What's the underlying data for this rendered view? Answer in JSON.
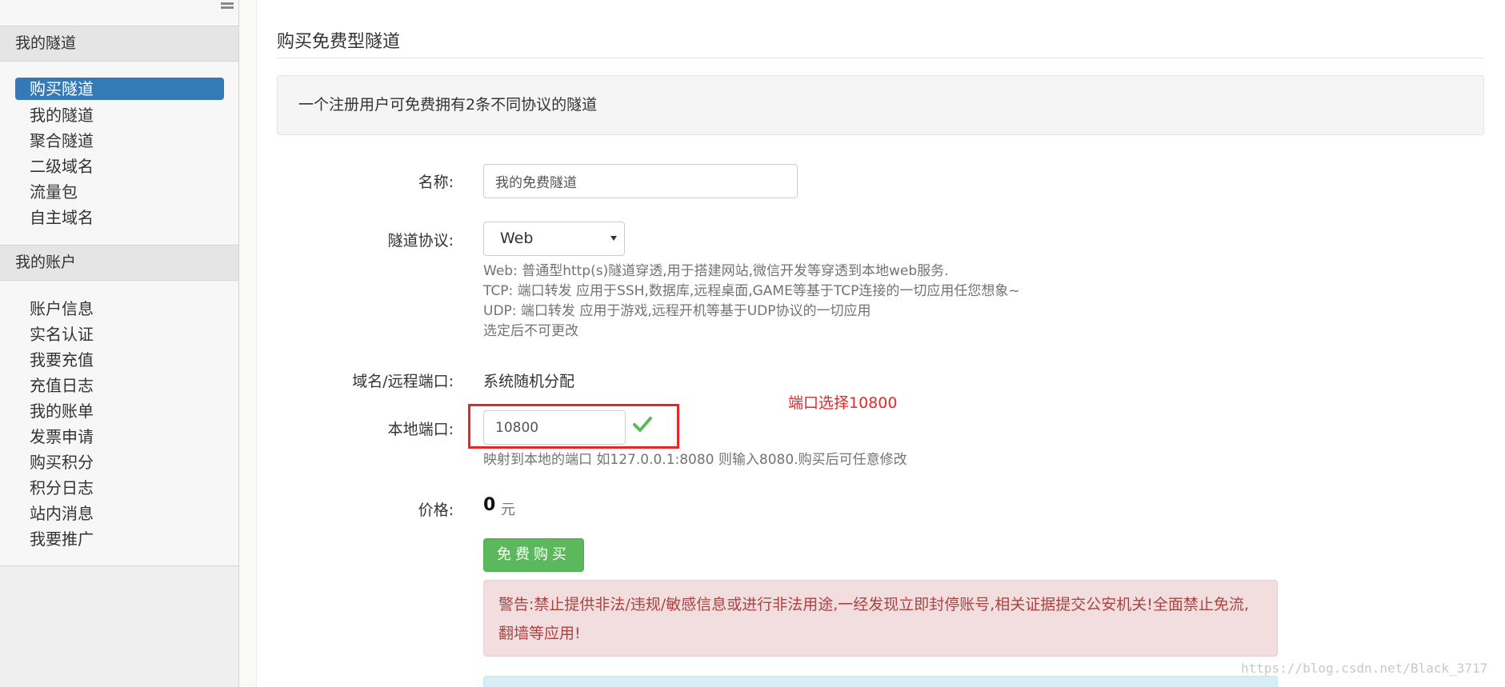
{
  "sidebar": {
    "groups": [
      {
        "title": "我的隧道",
        "items": [
          {
            "label": "购买隧道",
            "active": true
          },
          {
            "label": "我的隧道"
          },
          {
            "label": "聚合隧道"
          },
          {
            "label": "二级域名"
          },
          {
            "label": "流量包"
          },
          {
            "label": "自主域名"
          }
        ]
      },
      {
        "title": "我的账户",
        "items": [
          {
            "label": "账户信息"
          },
          {
            "label": "实名认证"
          },
          {
            "label": "我要充值"
          },
          {
            "label": "充值日志"
          },
          {
            "label": "我的账单"
          },
          {
            "label": "发票申请"
          },
          {
            "label": "购买积分"
          },
          {
            "label": "积分日志"
          },
          {
            "label": "站内消息"
          },
          {
            "label": "我要推广"
          }
        ]
      }
    ]
  },
  "main": {
    "title": "购买免费型隧道",
    "info": "一个注册用户可免费拥有2条不同协议的隧道",
    "form": {
      "name": {
        "label": "名称:",
        "value": "我的免费隧道"
      },
      "protocol": {
        "label": "隧道协议:",
        "selected": "Web",
        "help": [
          "Web: 普通型http(s)隧道穿透,用于搭建网站,微信开发等穿透到本地web服务.",
          "TCP: 端口转发 应用于SSH,数据库,远程桌面,GAME等基于TCP连接的一切应用任您想象~",
          "UDP: 端口转发 应用于游戏,远程开机等基于UDP协议的一切应用",
          "选定后不可更改"
        ]
      },
      "domain": {
        "label": "域名/远程端口:",
        "value": "系统随机分配"
      },
      "local_port": {
        "label": "本地端口:",
        "value": "10800",
        "help": "映射到本地的端口 如127.0.0.1:8080 则输入8080.购买后可任意修改"
      },
      "price": {
        "label": "价格:",
        "value": "0",
        "unit": "元"
      },
      "buy_button": "免费购买"
    },
    "warning": "警告:禁止提供非法/违规/敏感信息或进行非法用途,一经发现立即封停账号,相关证据提交公安机关!全面禁止免流,翻墙等应用!",
    "annotation": "端口选择10800",
    "watermark": "https://blog.csdn.net/Black_3717"
  },
  "colors": {
    "active_bg": "#337ab7",
    "success": "#5cb85c",
    "danger_text": "#a94442",
    "danger_bg": "#f2dede",
    "annotation": "#e8262a",
    "check": "#5cb85c"
  },
  "icons": {
    "menu_toggle": "menu-toggle-icon",
    "check": "check-icon",
    "caret": "caret-down-icon"
  }
}
